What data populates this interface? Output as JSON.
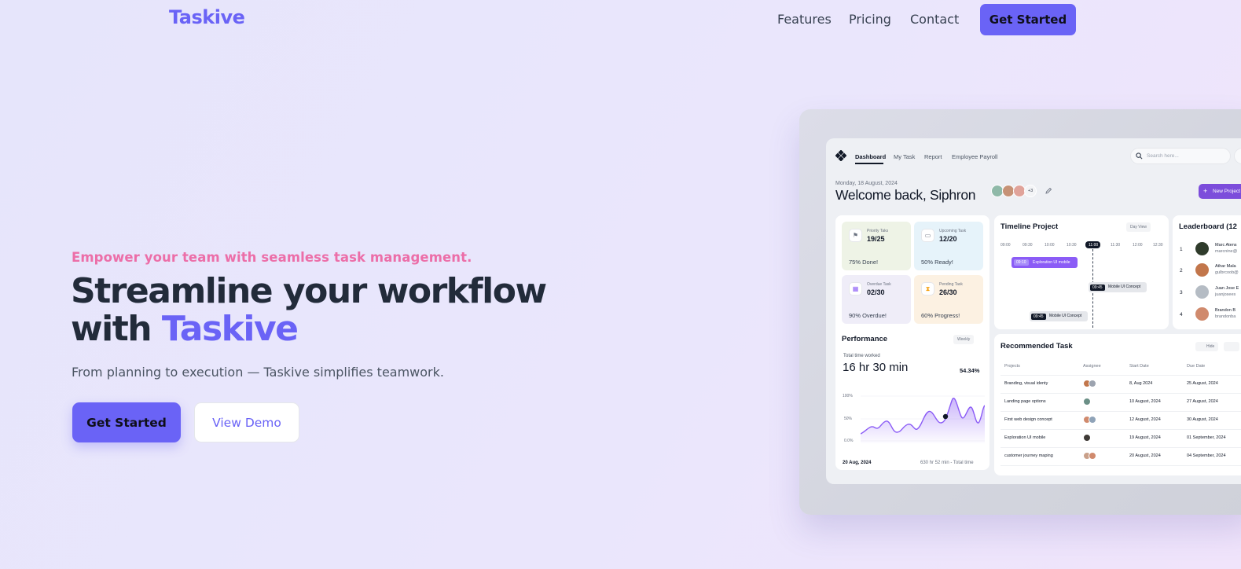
{
  "nav": {
    "logo": "Taskive",
    "links": [
      "Features",
      "Pricing",
      "Contact"
    ],
    "cta": "Get Started"
  },
  "hero": {
    "tagline": "Empower your team with seamless task management.",
    "headline_line1": "Streamline your workflow",
    "headline_with": "with",
    "headline_accent": "Taskive",
    "subhead": "From planning to execution — Taskive simplifies teamwork.",
    "primary_button": "Get Started",
    "secondary_button": "View Demo"
  },
  "colors": {
    "accent": "#6a63f6",
    "tagline": "#ec6ea8",
    "headline": "#222b3a"
  },
  "dashboard": {
    "tabs": [
      "Dashboard",
      "My Task",
      "Report",
      "Employee Payroll"
    ],
    "search_placeholder": "Search here...",
    "date": "Monday, 18 August, 2024",
    "welcome": "Welcome back, Siphron",
    "avatar_more": "+3",
    "new_project": "New Project",
    "stats": [
      {
        "label": "Priority Taks",
        "value": "19/25",
        "foot": "75% Done!",
        "icon": "flag-icon"
      },
      {
        "label": "Upcoming Task",
        "value": "12/20",
        "foot": "50% Ready!",
        "icon": "monitor-icon"
      },
      {
        "label": "Overdue Task",
        "value": "02/30",
        "foot": "90% Overdue!",
        "icon": "calendar-icon"
      },
      {
        "label": "Pending Task",
        "value": "26/30",
        "foot": "60% Progress!",
        "icon": "hourglass-icon"
      }
    ],
    "timeline": {
      "title": "Timeline Project",
      "view": "Day View",
      "times": [
        "09:00",
        "09:30",
        "10:00",
        "10:30",
        "11:00",
        "11:30",
        "12:00",
        "12:30"
      ],
      "current_time": "11:00",
      "events": [
        {
          "time": "09:10",
          "label": "Exploration UI mobile"
        },
        {
          "time": "09:45",
          "label": "Mobile UI Concept"
        },
        {
          "time": "09:45",
          "label": "Mobile UI Concept"
        }
      ]
    },
    "leaderboard": {
      "title": "Leaderboard (12",
      "entries": [
        {
          "rank": "1",
          "name": "Marc Atens",
          "email": "marcnine@"
        },
        {
          "rank": "2",
          "name": "Athar Mala",
          "email": "gulbrcoob@"
        },
        {
          "rank": "3",
          "name": "Juan Jose E",
          "email": "juanjosees"
        },
        {
          "rank": "4",
          "name": "Brandon B",
          "email": "brandonba"
        }
      ]
    },
    "performance": {
      "title": "Performance",
      "period": "Weekly",
      "total_label": "Total time worked",
      "total_value": "16 hr 30 min",
      "percent": "54.34%",
      "y_ticks": [
        "100%",
        "50%",
        "0.0%"
      ],
      "date": "20 Aug, 2024",
      "footer": "630 hr 52 min - Total time"
    },
    "recommended": {
      "title": "Recommended Task",
      "hide": "Hide",
      "columns": [
        "Projects",
        "Assignee",
        "Start Date",
        "Due Date"
      ],
      "rows": [
        {
          "project": "Branding, visual identy",
          "start": "8, Aug 2024",
          "due": "25 August, 2024"
        },
        {
          "project": "Landing page options",
          "start": "10 August, 2024",
          "due": "27 August, 2024"
        },
        {
          "project": "First web design concept",
          "start": "12 August, 2024",
          "due": "30 August, 2024"
        },
        {
          "project": "Exploration UI mobile",
          "start": "19 August, 2024",
          "due": "01 September, 2024"
        },
        {
          "project": "customer journey maping",
          "start": "20 August, 2024",
          "due": "04 September, 2024"
        }
      ]
    }
  }
}
